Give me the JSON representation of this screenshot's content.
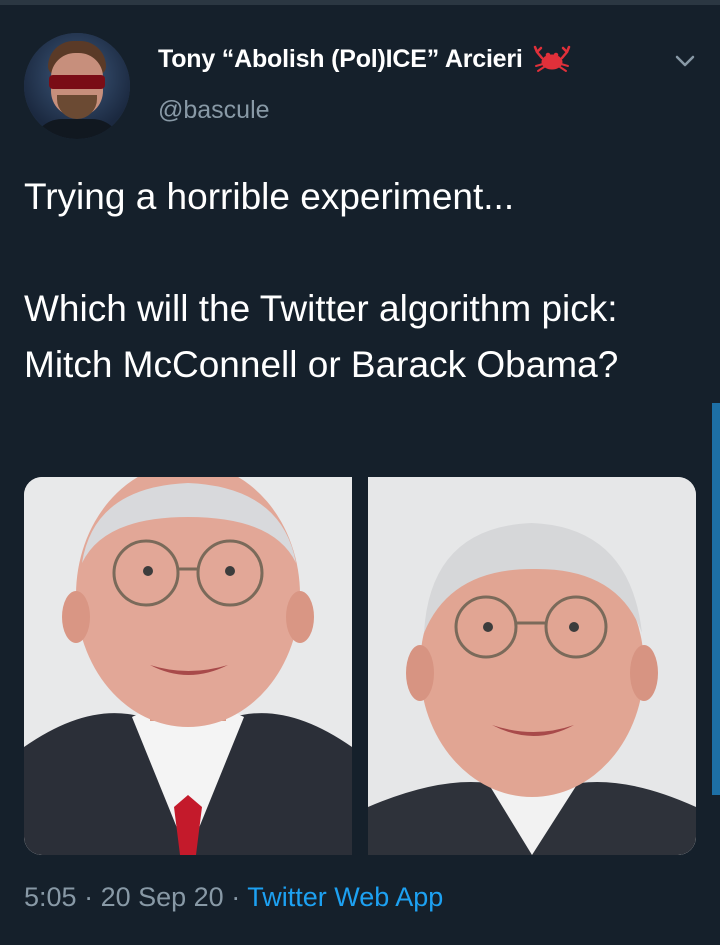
{
  "tweet": {
    "display_name": "Tony “Abolish (Pol)ICE” Arcieri",
    "handle": "@bascule",
    "text": "Trying a horrible experiment...\n\nWhich will the Twitter algorithm pick: Mitch McConnell or Barack Obama?",
    "time": "5:05",
    "separator": "·",
    "date": "20 Sep 20",
    "source": "Twitter Web App"
  },
  "icons": {
    "name_emoji": "crab-icon",
    "menu": "chevron-down-icon"
  },
  "colors": {
    "background": "#15202b",
    "secondary_text": "#8899a6",
    "link": "#1da1f2",
    "crab": "#e0303a"
  }
}
